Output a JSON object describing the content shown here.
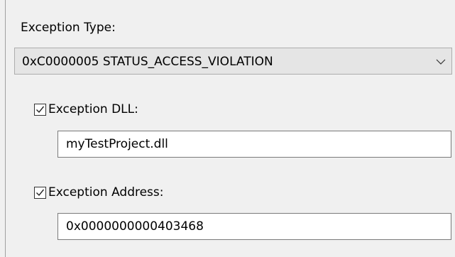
{
  "exception_type": {
    "label": "Exception Type:",
    "selected_value": "0xC0000005 STATUS_ACCESS_VIOLATION",
    "dropdown_icon": "chevron-down-icon"
  },
  "exception_dll": {
    "label": "Exception DLL:",
    "checked": true,
    "value": "myTestProject.dll"
  },
  "exception_address": {
    "label": "Exception Address:",
    "checked": true,
    "value": "0x0000000000403468"
  },
  "colors": {
    "background": "#f0f0f0",
    "combo_background": "#e5e5e5",
    "field_border": "#7a7a7a"
  }
}
